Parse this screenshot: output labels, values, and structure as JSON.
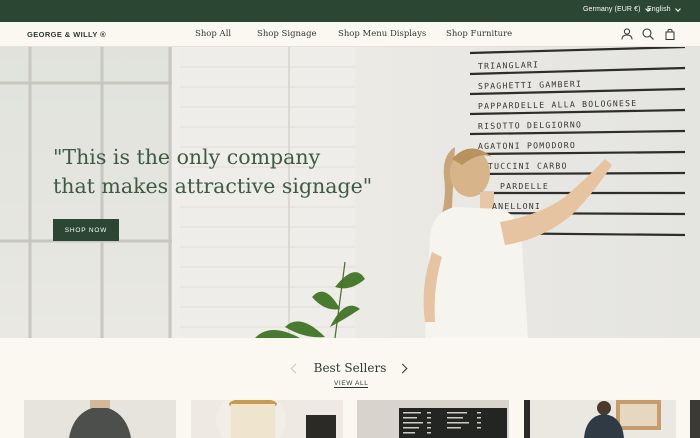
{
  "topbar": {
    "country": "Germany (EUR €)",
    "language": "English",
    "background": "#2b4633"
  },
  "header": {
    "logo": "GEORGE & WILLY ®",
    "nav": [
      "Shop All",
      "Shop Signage",
      "Shop Menu Displays",
      "Shop Furniture"
    ],
    "icons": [
      "account-icon",
      "search-icon",
      "cart-icon"
    ]
  },
  "hero": {
    "quote_line1": "\"This is the only company",
    "quote_line2": "that makes attractive signage\"",
    "cta": "SHOP NOW",
    "board_rows": [
      "TRIANGLARI",
      "SPAGHETTI GAMBERI",
      "PAPPARDELLE ALLA BOLOGNESE",
      "RISOTTO DELGIORNO",
      "AGATONI POMODORO",
      "TUCCINI CARBO",
      "PARDELLE",
      "ANELLONI"
    ]
  },
  "best_sellers": {
    "title": "Best Sellers",
    "view_all": "VIEW ALL"
  },
  "colors": {
    "accent": "#2b4633",
    "quote": "#3f5a43",
    "background": "#fbf8f1"
  }
}
